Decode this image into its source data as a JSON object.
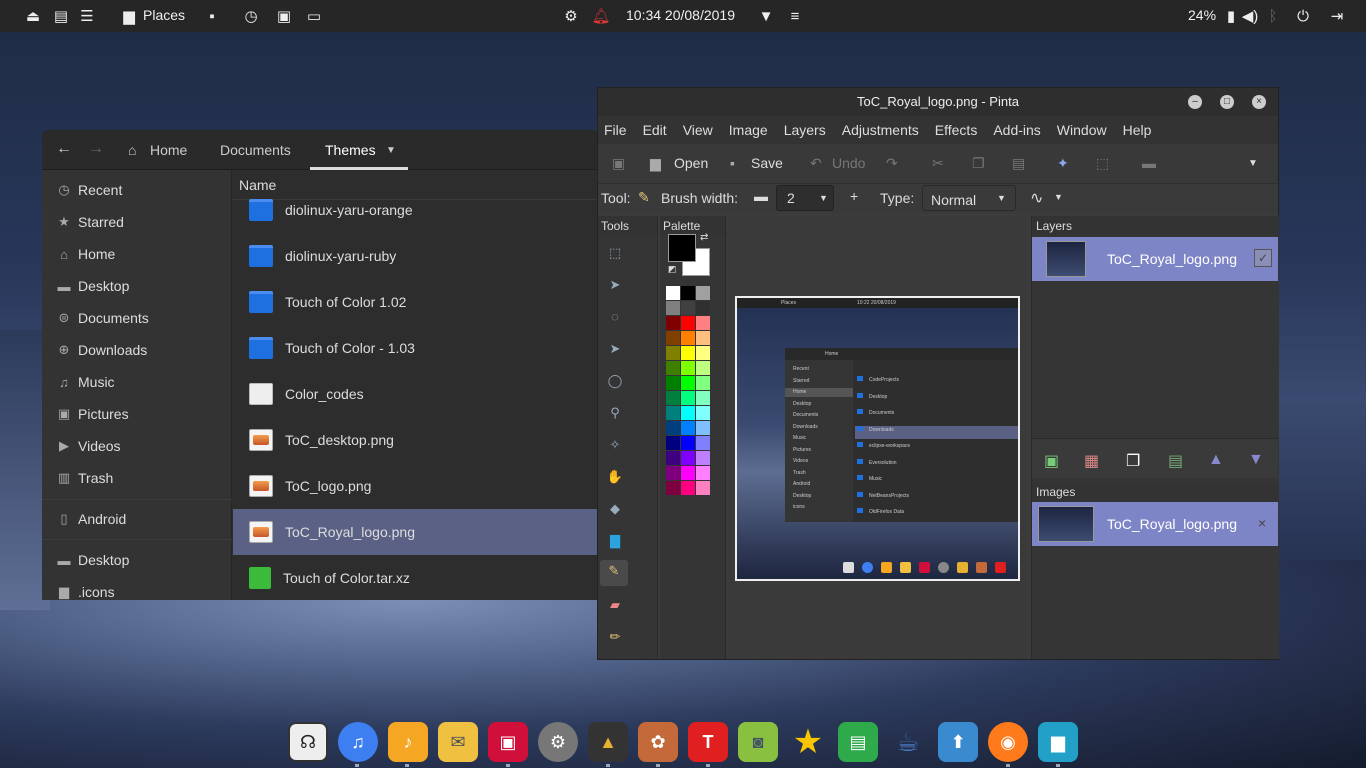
{
  "topbar": {
    "places": "Places",
    "clock": "10:34  20/08/2019",
    "battery": "24%"
  },
  "fm": {
    "crumbs": [
      "Home",
      "Documents",
      "Themes"
    ],
    "column_header": "Name",
    "sidebar": [
      "Recent",
      "Starred",
      "Home",
      "Desktop",
      "Documents",
      "Downloads",
      "Music",
      "Pictures",
      "Videos",
      "Trash",
      "Android",
      "Desktop",
      ".icons"
    ],
    "files": [
      "diolinux-yaru-orange",
      "diolinux-yaru-ruby",
      "Touch of Color 1.02",
      "Touch of Color - 1.03",
      "Color_codes",
      "ToC_desktop.png",
      "ToC_logo.png",
      "ToC_Royal_logo.png",
      "Touch of Color.tar.xz"
    ]
  },
  "pinta": {
    "title": "ToC_Royal_logo.png - Pinta",
    "menu": [
      "File",
      "Edit",
      "View",
      "Image",
      "Layers",
      "Adjustments",
      "Effects",
      "Add-ins",
      "Window",
      "Help"
    ],
    "toolbar": {
      "open": "Open",
      "save": "Save",
      "undo": "Undo"
    },
    "toolopts": {
      "tool": "Tool:",
      "brush_width": "Brush width:",
      "width_value": "2",
      "type": "Type:",
      "type_value": "Normal"
    },
    "panels": {
      "tools": "Tools",
      "palette": "Palette",
      "layers": "Layers",
      "images": "Images"
    },
    "layer_name": "ToC_Royal_logo.png",
    "image_name": "ToC_Royal_logo.png",
    "mini": {
      "places": "Places",
      "clock": "10:22  20/08/2019",
      "home": "Home",
      "side": [
        "Recent",
        "Starred",
        "Home",
        "Desktop",
        "Documents",
        "Downloads",
        "Music",
        "Pictures",
        "Videos",
        "Trash",
        "Android",
        "Desktop",
        "icons"
      ],
      "files": [
        "CodeProjects",
        "Desktop",
        "Documents",
        "Downloads",
        "eclipse-workspace",
        "Eversolution",
        "Music",
        "NetBeansProjects",
        "OldFirefox Data"
      ]
    }
  }
}
